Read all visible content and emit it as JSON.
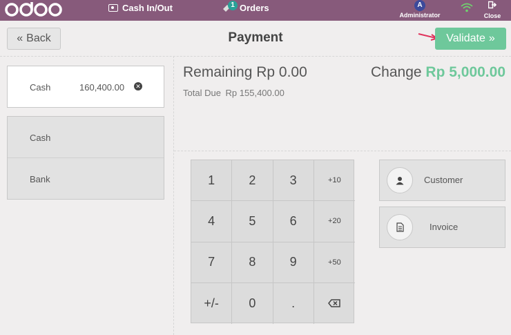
{
  "topbar": {
    "logo": "odoo",
    "cash_in_out_label": "Cash In/Out",
    "orders_label": "Orders",
    "orders_badge": "1",
    "avatar_initial": "A",
    "user_label": "Administrator",
    "close_label": "Close",
    "bar_color": "#875a7b"
  },
  "header": {
    "back_label": "Back",
    "title": "Payment",
    "validate_label": "Validate",
    "validate_color": "#6ec89b"
  },
  "paymentline": {
    "name": "Cash",
    "amount": "160,400.00"
  },
  "methods": [
    "Cash",
    "Bank"
  ],
  "summary": {
    "remaining_label": "Remaining",
    "remaining_value": "Rp 0.00",
    "total_due_label": "Total Due",
    "total_due_value": "Rp 155,400.00",
    "change_label": "Change",
    "change_value": "Rp 5,000.00"
  },
  "numpad": [
    "1",
    "2",
    "3",
    "+10",
    "4",
    "5",
    "6",
    "+20",
    "7",
    "8",
    "9",
    "+50",
    "+/-",
    "0",
    "."
  ],
  "side": {
    "customer_label": "Customer",
    "invoice_label": "Invoice"
  }
}
